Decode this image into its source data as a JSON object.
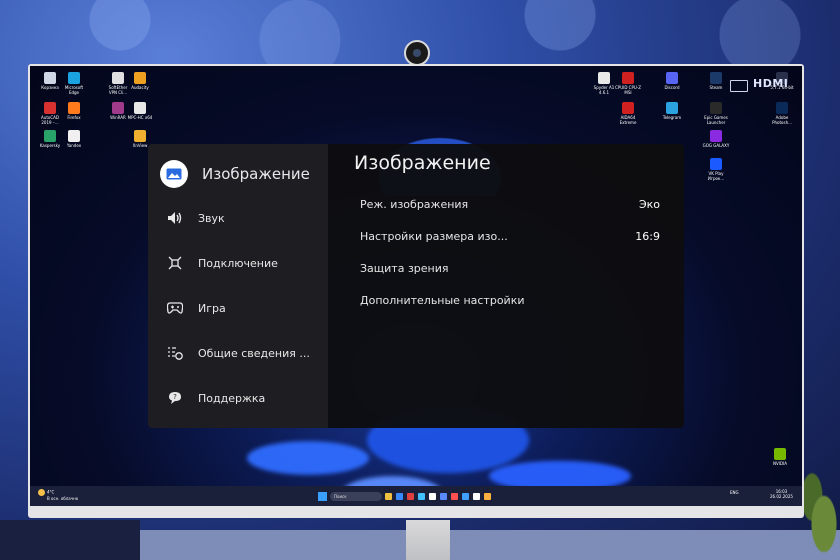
{
  "osd": {
    "title": "Изображение",
    "sidebar": [
      {
        "label": "Изображение",
        "icon": "picture-icon",
        "active": true
      },
      {
        "label": "Звук",
        "icon": "speaker-icon"
      },
      {
        "label": "Подключение",
        "icon": "connection-icon"
      },
      {
        "label": "Игра",
        "icon": "gamepad-icon"
      },
      {
        "label": "Общие сведения ...",
        "icon": "general-info-icon"
      },
      {
        "label": "Поддержка",
        "icon": "support-icon"
      }
    ],
    "options": [
      {
        "label": "Реж. изображения",
        "value": "Эко"
      },
      {
        "label": "Настройки размера изо...",
        "value": "16:9"
      },
      {
        "label": "Защита зрения",
        "value": ""
      },
      {
        "label": "Дополнительные настройки",
        "value": ""
      }
    ]
  },
  "desktop": {
    "icons_left": [
      {
        "label": "Корзина",
        "color": "#cfd6e6"
      },
      {
        "label": "Microsoft Edge",
        "color": "#1aa3e0"
      },
      {
        "label": "SoftEther VPN Cli...",
        "color": "#e0e0e0"
      },
      {
        "label": "Audacity",
        "color": "#f0a020"
      },
      {
        "label": "AutoCAD 2019 –...",
        "color": "#d93030"
      },
      {
        "label": "Firefox",
        "color": "#ff7a1a"
      },
      {
        "label": "WinRAR",
        "color": "#a03a8a"
      },
      {
        "label": "MPC-HC x64",
        "color": "#e8e8e8"
      },
      {
        "label": "Kaspersky",
        "color": "#2aa36a"
      },
      {
        "label": "Yandex",
        "color": "#f0f0f0"
      },
      {
        "label": "XnView",
        "color": "#f0b030"
      }
    ],
    "icons_right": [
      {
        "label": "Spyder A1 4.6.1",
        "color": "#e8e8e8"
      },
      {
        "label": "CPUID CPU-Z MSI",
        "color": "#d02020"
      },
      {
        "label": "Discord",
        "color": "#5865f2"
      },
      {
        "label": "Steam",
        "color": "#1b3a6a"
      },
      {
        "label": "5.7.1 64-bit",
        "color": "#2a2f4a"
      },
      {
        "label": "AIDA64 Extreme",
        "color": "#d02020"
      },
      {
        "label": "Telegram",
        "color": "#2aa3e0"
      },
      {
        "label": "Epic Games Launcher",
        "color": "#2a2a2a"
      },
      {
        "label": "Adobe Photosh...",
        "color": "#0a2a5a"
      },
      {
        "label": "GOG GALAXY",
        "color": "#8a2be2"
      },
      {
        "label": "VK Play Игрок...",
        "color": "#1a5aff"
      },
      {
        "label": "NVIDIA",
        "color": "#76b900"
      }
    ],
    "hdmi_label": "HDMI"
  },
  "taskbar": {
    "weather_temp": "4°C",
    "weather_text": "В осн. облачно",
    "search_placeholder": "Поиск",
    "lang": "ENG",
    "time": "16:03",
    "date": "26.02.2025",
    "apps": [
      "#f0c040",
      "#3a8aff",
      "#e04040",
      "#40c0ff",
      "#ffffff",
      "#5a8aff",
      "#ff5050",
      "#40a0ff",
      "#ffffff",
      "#ffb040"
    ]
  }
}
